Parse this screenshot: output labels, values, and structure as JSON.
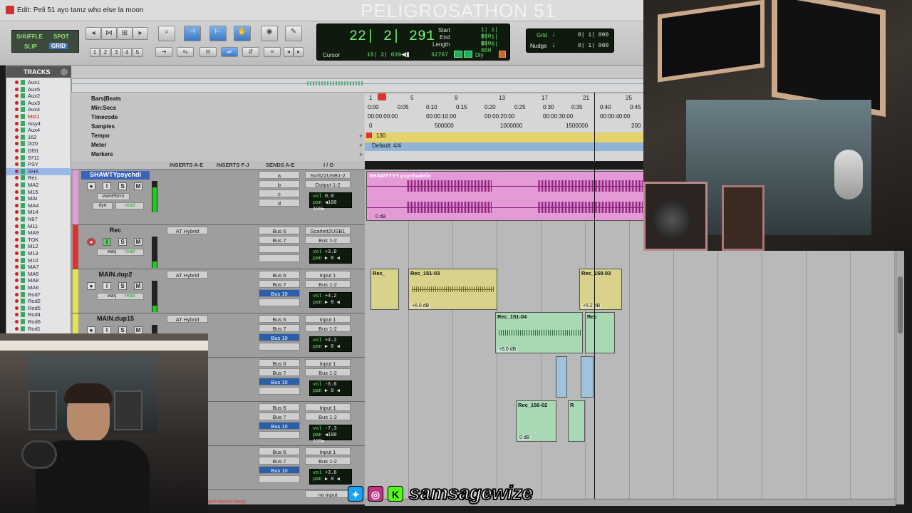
{
  "window": {
    "title": "Edit: Peli 51 ayo tamz who else la moon"
  },
  "overlay": {
    "stream_title": "PELIGROSATHON 51",
    "social_handle": "samsagewize"
  },
  "edit_modes": {
    "shuffle": "SHUFFLE",
    "spot": "SPOT",
    "slip": "SLIP",
    "grid": "GRID"
  },
  "zoom_presets": [
    "1",
    "2",
    "3",
    "4",
    "5"
  ],
  "counter": {
    "main": "22| 2| 291",
    "start_label": "Start",
    "start_val": "1| 1| 000",
    "end_label": "End",
    "end_val": "1| 1| 000",
    "length_label": "Length",
    "length_val": "0| 0| 000",
    "cursor_label": "Cursor",
    "cursor_val": "15| 2| 039",
    "samples_val": "32767",
    "dly_label": "Dly"
  },
  "grid": {
    "grid_label": "Grid",
    "grid_val": "0| 1| 000",
    "nudge_label": "Nudge",
    "nudge_val": "0| 1| 000"
  },
  "tracks_panel": {
    "header": "TRACKS",
    "items": [
      "Aux1",
      "Aux5",
      "Aux2",
      "Aux3",
      "Aux4",
      "Mst1",
      "msy4",
      "Aux4",
      "162",
      "l320",
      "Dl91",
      "9711",
      "PSY",
      "SHA",
      "Rec",
      "MA2",
      "M15",
      "MAI",
      "MA4",
      "M14",
      "N97",
      "M11",
      "MA9",
      "TOK",
      "M12",
      "M13",
      "M10",
      "MA7",
      "MA5",
      "MA8",
      "MA6",
      "Rod7",
      "Rod2",
      "Rod5",
      "Rod4",
      "Rod6",
      "Rod1"
    ]
  },
  "rulers": {
    "bars_beats": "Bars|Beats",
    "min_secs": "Min:Secs",
    "timecode": "Timecode",
    "samples": "Samples",
    "tempo": "Tempo",
    "meter": "Meter",
    "markers": "Markers",
    "bar_ticks": [
      "1",
      "5",
      "9",
      "13",
      "17",
      "21",
      "25"
    ],
    "sec_ticks": [
      "0:00",
      "0:05",
      "0:10",
      "0:15",
      "0:20",
      "0:25",
      "0:30",
      "0:35",
      "0:40",
      "0:45"
    ],
    "tc_ticks": [
      "00:00:00:00",
      "00:00:10:00",
      "00:00:20:00",
      "00:00:30:00",
      "00:00:40:00"
    ],
    "sample_ticks": [
      "0",
      "500000",
      "1000000",
      "1500000",
      "200"
    ],
    "tempo_val": "130",
    "meter_val": "Default: 4/4"
  },
  "mix_header": {
    "inserts_ae": "INSERTS A-E",
    "inserts_fj": "INSERTS F-J",
    "sends_ae": "SENDS A-E",
    "io": "I / O"
  },
  "tracks": [
    {
      "name": "SHAWTYpsychdl",
      "mode": "waveform",
      "dyn": "dyn",
      "read": "read",
      "insert": "",
      "sends": [
        "a",
        "b",
        "c",
        "d"
      ],
      "io_in": "Scrlt22USB1-2",
      "io_out": "Output 1-2",
      "vol": "0.0",
      "pan": "◀100  100▶"
    },
    {
      "name": "Rec",
      "mode": "wave",
      "read": "read",
      "insert": "AT Hybrid",
      "sends": [
        "Bus 6",
        "Bus 7",
        "",
        ""
      ],
      "io_in": "Scarlett2USB1",
      "io_out": "Bus 1-2",
      "vol": "+3.0",
      "pan": "▶ 0 ◀"
    },
    {
      "name": "MAIN.dup2",
      "mode": "wave",
      "read": "read",
      "insert": "AT Hybrid",
      "sends": [
        "Bus 6",
        "Bus 7",
        "Bus 10",
        ""
      ],
      "io_in": "Input 1",
      "io_out": "Bus 1-2",
      "vol": "+4.2",
      "pan": "▶ 0 ◀"
    },
    {
      "name": "MAIN.dup15",
      "mode": "wave",
      "read": "read",
      "insert": "AT Hybrid",
      "sends": [
        "Bus 6",
        "Bus 7",
        "Bus 10",
        ""
      ],
      "io_in": "Input 1",
      "io_out": "Bus 1-2",
      "vol": "+4.2",
      "pan": "▶ 0 ◀"
    },
    {
      "name": "",
      "mode": "",
      "read": "",
      "insert": "",
      "sends": [
        "Bus 6",
        "Bus 7",
        "Bus 10",
        ""
      ],
      "io_in": "Input 1",
      "io_out": "Bus 1-2",
      "vol": "-6.6",
      "pan": "▶ 0 ◀"
    },
    {
      "name": "",
      "mode": "",
      "read": "",
      "insert": "",
      "sends": [
        "Bus 6",
        "Bus 7",
        "Bus 10",
        ""
      ],
      "io_in": "Input 1",
      "io_out": "Bus 1-2",
      "vol": "-7.3",
      "pan": "◀100  100▶"
    },
    {
      "name": "",
      "mode": "",
      "read": "",
      "insert": "",
      "sends": [
        "Bus 6",
        "Bus 7",
        "Bus 10",
        ""
      ],
      "io_in": "Input 1",
      "io_out": "Bus 1-2",
      "vol": "+3.6",
      "pan": "▶ 0 ◀"
    }
  ],
  "last_io": "no input",
  "clips": {
    "c1": {
      "name": "SHAWTYYY psychadelic",
      "gain": "0 dB"
    },
    "c2": {
      "name": "Rec_",
      "gain": ""
    },
    "c3": {
      "name": "Rec_151-03",
      "gain": "+6.0 dB"
    },
    "c4": {
      "name": "Rec_158-03",
      "gain": "+5.2 dB"
    },
    "c5": {
      "name": "Rec_151-04",
      "gain": "+6.0 dB"
    },
    "c6": {
      "name": "Rec",
      "gain": ""
    },
    "c7": {
      "name": "Rec_156-02",
      "gain": "0 dB"
    },
    "c8": {
      "name": "R",
      "gain": ""
    }
  },
  "status": "port record ready",
  "colors": {
    "audio_pink": "#e39ad6",
    "audio_yellow": "#d8d28a",
    "audio_green": "#a8d8b4",
    "audio_blue": "#9fc3dc",
    "counter_green": "#6ee86e"
  }
}
